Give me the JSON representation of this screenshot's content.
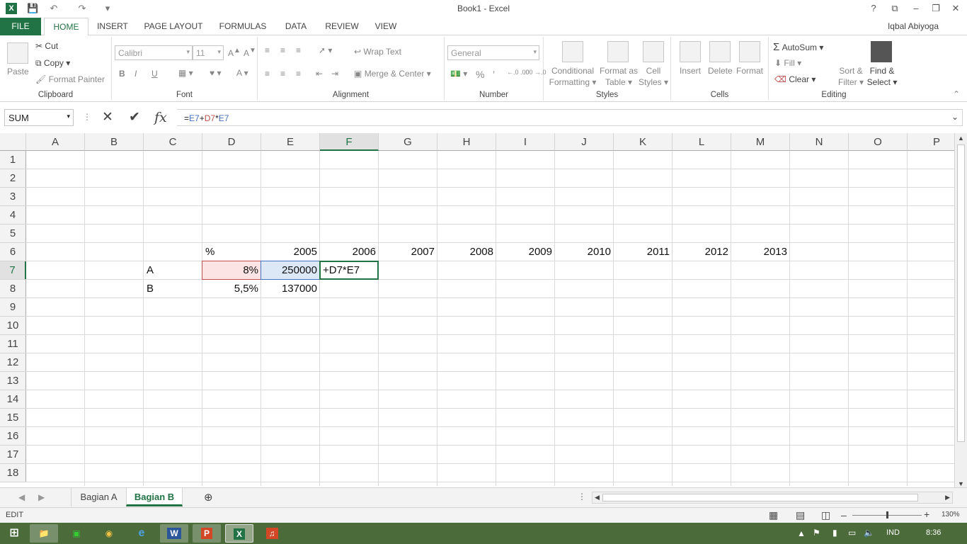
{
  "window": {
    "title": "Book1 - Excel"
  },
  "qat": {
    "app_icon": "excel-icon",
    "save": "save-icon",
    "undo": "undo-icon",
    "redo": "redo-icon"
  },
  "window_controls": {
    "help": "?",
    "restore_ribbon": "⧉",
    "minimize": "–",
    "restore": "❐",
    "close": "✕"
  },
  "tabs": [
    "FILE",
    "HOME",
    "INSERT",
    "PAGE LAYOUT",
    "FORMULAS",
    "DATA",
    "REVIEW",
    "VIEW"
  ],
  "active_tab": "HOME",
  "user": {
    "name": "Iqbal Abiyoga"
  },
  "ribbon": {
    "clipboard": {
      "label": "Clipboard",
      "paste": "Paste",
      "cut": "Cut",
      "copy": "Copy",
      "format_painter": "Format Painter"
    },
    "font": {
      "label": "Font",
      "family": "Calibri",
      "size": "11",
      "bold": "B",
      "italic": "I",
      "underline": "U"
    },
    "alignment": {
      "label": "Alignment",
      "wrap": "Wrap Text",
      "merge": "Merge & Center"
    },
    "number": {
      "label": "Number",
      "format": "General",
      "percent": "%",
      "comma": "’",
      "inc_decimal": "←.0 .00",
      "dec_decimal": ".00 →.0"
    },
    "styles": {
      "label": "Styles",
      "conditional": [
        "Conditional",
        "Formatting"
      ],
      "format_table": [
        "Format as",
        "Table"
      ],
      "cell_styles": [
        "Cell",
        "Styles"
      ]
    },
    "cells": {
      "label": "Cells",
      "insert": "Insert",
      "delete": "Delete",
      "format": "Format"
    },
    "editing": {
      "label": "Editing",
      "autosum": "AutoSum",
      "fill": "Fill",
      "clear": "Clear",
      "sort": [
        "Sort &",
        "Filter"
      ],
      "find": [
        "Find &",
        "Select"
      ]
    }
  },
  "formula_bar": {
    "name_box": "SUM",
    "fx": "fx",
    "formula_parts": [
      {
        "text": "=",
        "color": "#222222"
      },
      {
        "text": "E7",
        "color": "#4472c4"
      },
      {
        "text": "+",
        "color": "#222222"
      },
      {
        "text": "D7",
        "color": "#c0504d"
      },
      {
        "text": "*",
        "color": "#222222"
      },
      {
        "text": "E7",
        "color": "#4472c4"
      }
    ]
  },
  "sheet": {
    "columns": [
      "A",
      "B",
      "C",
      "D",
      "E",
      "F",
      "G",
      "H",
      "I",
      "J",
      "K",
      "L",
      "M",
      "N",
      "O",
      "P"
    ],
    "selected_column": "F",
    "rows": [
      1,
      2,
      3,
      4,
      5,
      6,
      7,
      8,
      9,
      10,
      11,
      12,
      13,
      14,
      15,
      16,
      17,
      18
    ],
    "selected_row": 7,
    "cells": {
      "D6": "%",
      "E6": "2005",
      "F6": "2006",
      "G6": "2007",
      "H6": "2008",
      "I6": "2009",
      "J6": "2010",
      "K6": "2011",
      "L6": "2012",
      "M6": "2013",
      "C7": "A",
      "D7": "8%",
      "E7": "250000",
      "F7": "+D7*E7",
      "C8": "B",
      "D8": "5,5%",
      "E8": "137000"
    }
  },
  "sheet_tabs": [
    "Bagian A",
    "Bagian B"
  ],
  "active_sheet": "Bagian B",
  "status": {
    "mode": "EDIT",
    "zoom": "130%"
  },
  "taskbar": {
    "lang": "IND",
    "time": "8:36",
    "apps": [
      "explorer-icon",
      "camtasia-icon",
      "chrome-icon",
      "ie-icon",
      "word-icon",
      "powerpoint-icon",
      "excel-icon",
      "music-icon"
    ]
  },
  "colors": {
    "accent": "#217346",
    "ref_blue": "#4472c4",
    "ref_red": "#c0504d"
  }
}
